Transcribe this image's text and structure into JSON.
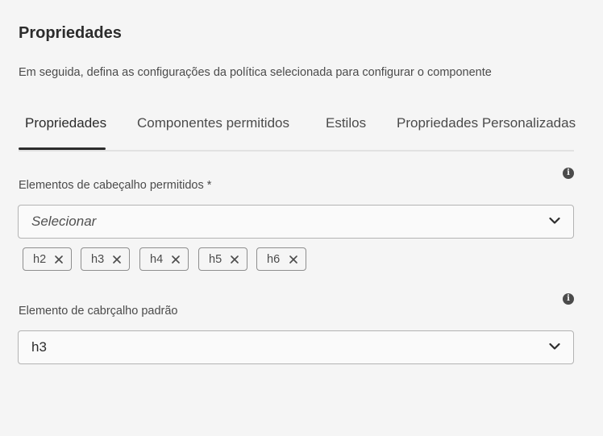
{
  "header": {
    "title": "Propriedades",
    "subtitle": "Em seguida, defina as configurações da política selecionada para configurar o componente"
  },
  "tabs": [
    {
      "label": "Propriedades",
      "selected": true
    },
    {
      "label": "Componentes permitidos",
      "selected": false
    },
    {
      "label": "Estilos",
      "selected": false
    },
    {
      "label": "Propriedades Personalizadas",
      "selected": false
    }
  ],
  "allowed_headings": {
    "label": "Elementos de cabeçalho permitidos *",
    "placeholder": "Selecionar",
    "tags": [
      "h2",
      "h3",
      "h4",
      "h5",
      "h6"
    ],
    "info_icon": "info-icon"
  },
  "default_heading": {
    "label": "Elemento de cabrçalho padrão",
    "value": "h3",
    "info_icon": "info-icon"
  },
  "icons": {
    "chevron": "chevron-down-icon",
    "remove": "close-icon"
  },
  "colors": {
    "background": "#f5f5f5",
    "text": "#2c2c2c",
    "secondary_text": "#4b4b4b",
    "border": "#b3b3b3",
    "tab_indicator": "#2c2c2c"
  }
}
